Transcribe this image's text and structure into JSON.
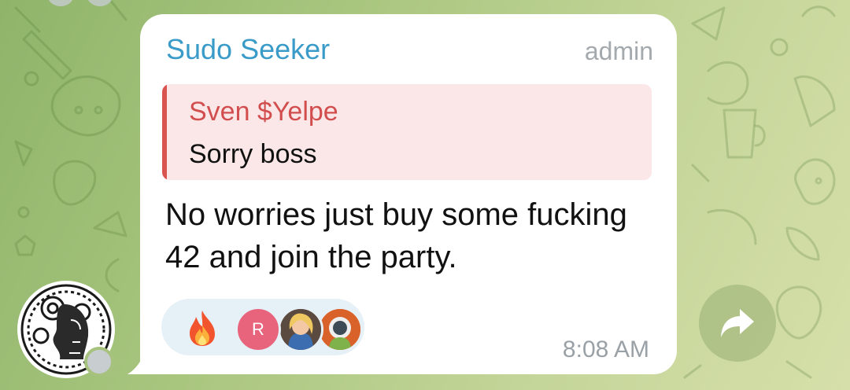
{
  "message": {
    "sender_name": "Sudo Seeker",
    "role_badge": "admin",
    "reply": {
      "name": "Sven $Yelpe",
      "text": "Sorry boss"
    },
    "text": "No worries just buy some fucking 42 and join the party.",
    "time": "8:08 AM",
    "reactions": {
      "emoji_icon": "fire-emoji",
      "reactor_initial": "R"
    }
  },
  "icons": {
    "forward": "forward-arrow-icon"
  },
  "colors": {
    "sender_name": "#3a9bc8",
    "reply_accent": "#d9534f",
    "reply_bg": "#fbe7e7",
    "reactions_bg": "#e6f0f7",
    "reactor_r": "#e8647c"
  }
}
